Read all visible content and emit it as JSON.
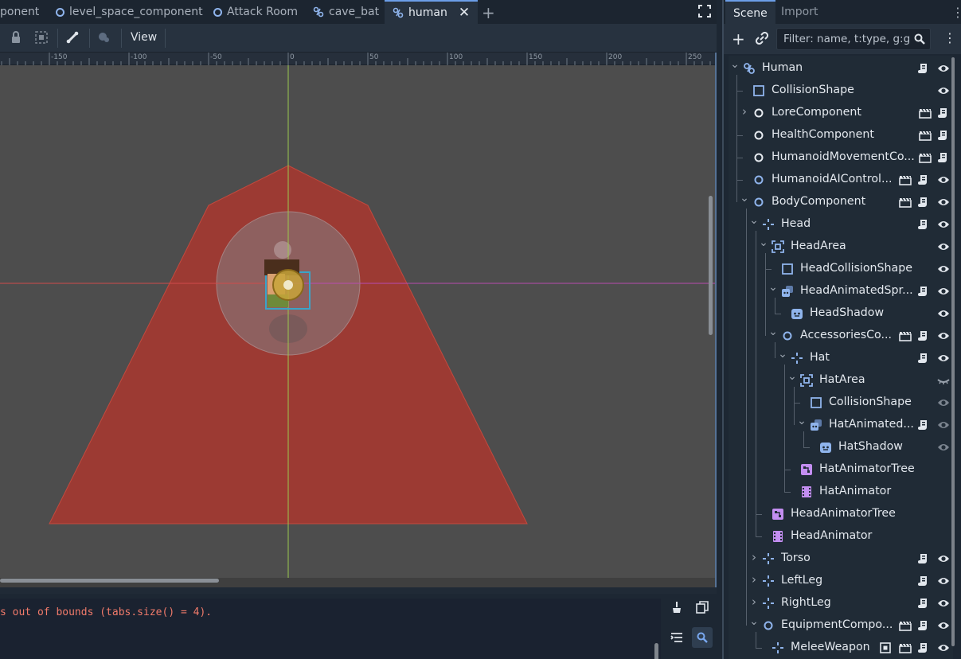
{
  "tabs": [
    {
      "label": "ponent",
      "icon": "node-circle-icon"
    },
    {
      "label": "level_space_component",
      "icon": "node-circle-icon"
    },
    {
      "label": "Attack Room",
      "icon": "node-circle-icon"
    },
    {
      "label": "cave_bat",
      "icon": "skeleton-icon"
    },
    {
      "label": "human",
      "icon": "skeleton-icon",
      "active": true
    }
  ],
  "toolbar": {
    "view_label": "View"
  },
  "ruler_labels": [
    "-150",
    "-100",
    "-50",
    "0",
    "50",
    "100",
    "150",
    "200",
    "250"
  ],
  "output": {
    "message": "s out of bounds (tabs.size() = 4)."
  },
  "dock": {
    "tabs": [
      "Scene",
      "Import"
    ],
    "filter_placeholder": "Filter: name, t:type, g:gr"
  },
  "colors": {
    "accent": "#6c9ee8",
    "error_text": "#f07a6a",
    "cone_fill": "#9c3a33",
    "background": "#1d2733"
  },
  "tree": [
    {
      "label": "Human",
      "icon": "skeleton-icon",
      "depth": 0,
      "arrow": "down",
      "right": [
        "script",
        "eye"
      ]
    },
    {
      "label": "CollisionShape",
      "icon": "square-outline-icon",
      "depth": 1,
      "right": [
        "eye"
      ]
    },
    {
      "label": "LoreComponent",
      "icon": "white-circle-icon",
      "depth": 1,
      "arrow": "right",
      "right": [
        "clapper",
        "script"
      ]
    },
    {
      "label": "HealthComponent",
      "icon": "white-circle-icon",
      "depth": 1,
      "right": [
        "clapper",
        "script"
      ]
    },
    {
      "label": "HumanoidMovementCo...",
      "icon": "white-circle-icon",
      "depth": 1,
      "right": [
        "clapper",
        "script"
      ]
    },
    {
      "label": "HumanoidAIControl...",
      "icon": "blue-circle-icon",
      "depth": 1,
      "right": [
        "clapper",
        "script",
        "eye"
      ]
    },
    {
      "label": "BodyComponent",
      "icon": "blue-circle-icon",
      "depth": 1,
      "arrow": "down",
      "right": [
        "clapper",
        "script",
        "eye"
      ]
    },
    {
      "label": "Head",
      "icon": "crosshair-icon",
      "depth": 2,
      "arrow": "down",
      "right": [
        "script",
        "eye"
      ]
    },
    {
      "label": "HeadArea",
      "icon": "area-icon",
      "depth": 3,
      "arrow": "down",
      "right": [
        "eye"
      ]
    },
    {
      "label": "HeadCollisionShape",
      "icon": "square-outline-icon",
      "depth": 4,
      "right": [
        "eye"
      ]
    },
    {
      "label": "HeadAnimatedSpr...",
      "icon": "animated-sprite-icon",
      "depth": 4,
      "arrow": "down",
      "right": [
        "script",
        "eye"
      ]
    },
    {
      "label": "HeadShadow",
      "icon": "sprite-icon",
      "depth": 5,
      "right": [
        "eye"
      ]
    },
    {
      "label": "AccessoriesCo...",
      "icon": "blue-circle-icon",
      "depth": 4,
      "arrow": "down",
      "right": [
        "clapper",
        "script",
        "eye"
      ]
    },
    {
      "label": "Hat",
      "icon": "crosshair-icon",
      "depth": 5,
      "arrow": "down",
      "right": [
        "script",
        "eye"
      ]
    },
    {
      "label": "HatArea",
      "icon": "area-icon",
      "depth": 6,
      "arrow": "down",
      "right": [
        "eye-closed"
      ]
    },
    {
      "label": "CollisionShape",
      "icon": "square-outline-icon",
      "depth": 7,
      "right": [
        "eye-dim"
      ]
    },
    {
      "label": "HatAnimated...",
      "icon": "animated-sprite-icon",
      "depth": 7,
      "arrow": "down",
      "right": [
        "script",
        "eye-dim"
      ]
    },
    {
      "label": "HatShadow",
      "icon": "sprite-icon",
      "depth": 8,
      "right": [
        "eye-dim"
      ]
    },
    {
      "label": "HatAnimatorTree",
      "icon": "animation-tree-icon",
      "depth": 6,
      "right": []
    },
    {
      "label": "HatAnimator",
      "icon": "animation-player-icon",
      "depth": 6,
      "right": []
    },
    {
      "label": "HeadAnimatorTree",
      "icon": "animation-tree-icon",
      "depth": 3,
      "right": []
    },
    {
      "label": "HeadAnimator",
      "icon": "animation-player-icon",
      "depth": 3,
      "right": []
    },
    {
      "label": "Torso",
      "icon": "crosshair-icon",
      "depth": 2,
      "arrow": "right",
      "right": [
        "script",
        "eye"
      ]
    },
    {
      "label": "LeftLeg",
      "icon": "crosshair-icon",
      "depth": 2,
      "arrow": "right",
      "right": [
        "script",
        "eye"
      ]
    },
    {
      "label": "RightLeg",
      "icon": "crosshair-icon",
      "depth": 2,
      "arrow": "right",
      "right": [
        "script",
        "eye"
      ]
    },
    {
      "label": "EquipmentCompo...",
      "icon": "blue-circle-icon",
      "depth": 2,
      "arrow": "down",
      "right": [
        "clapper",
        "script",
        "eye"
      ]
    },
    {
      "label": "MeleeWeapon",
      "icon": "crosshair-icon",
      "depth": 3,
      "right": [
        "target",
        "clapper",
        "script",
        "eye"
      ]
    }
  ]
}
